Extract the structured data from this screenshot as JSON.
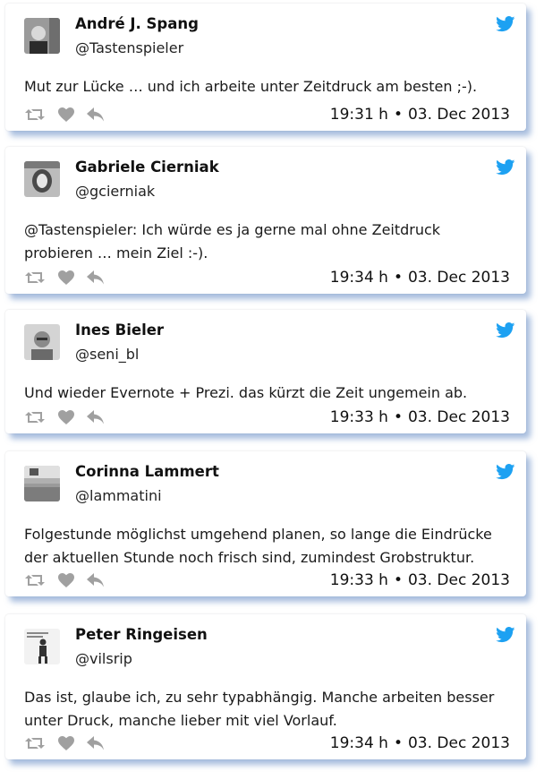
{
  "colors": {
    "accent_bird": "#1da1f2",
    "icon_gray": "#a0a0a0",
    "card_shadow": "#5f87c3"
  },
  "tweets": [
    {
      "name": "André J. Spang",
      "handle": "@Tastenspieler",
      "text": "Mut zur Lücke … und ich arbeite unter Zeitdruck am besten ;-).",
      "time": "19:31 h",
      "date": "03. Dec 2013",
      "separator": "•"
    },
    {
      "name": "Gabriele Cierniak",
      "handle": "@gcierniak",
      "text": "@Tastenspieler: Ich würde es ja gerne mal ohne Zeitdruck probieren … mein Ziel :-).",
      "time": "19:34 h",
      "date": "03. Dec 2013",
      "separator": "•"
    },
    {
      "name": "Ines Bieler",
      "handle": "@seni_bl",
      "text": "Und wieder Evernote + Prezi. das kürzt die Zeit ungemein ab.",
      "time": "19:33 h",
      "date": "03. Dec 2013",
      "separator": "•"
    },
    {
      "name": "Corinna Lammert",
      "handle": "@lammatini",
      "text": "Folgestunde möglichst umgehend planen, so lange die Eindrücke der aktuellen Stunde noch frisch sind, zumindest Grobstruktur.",
      "time": "19:33 h",
      "date": "03. Dec 2013",
      "separator": "•"
    },
    {
      "name": "Peter Ringeisen",
      "handle": "@vilsrip",
      "text": "Das ist, glaube ich, zu sehr typabhängig. Manche arbeiten besser unter Druck, manche lieber mit viel Vorlauf.",
      "time": "19:34 h",
      "date": "03. Dec 2013",
      "separator": "•"
    }
  ]
}
